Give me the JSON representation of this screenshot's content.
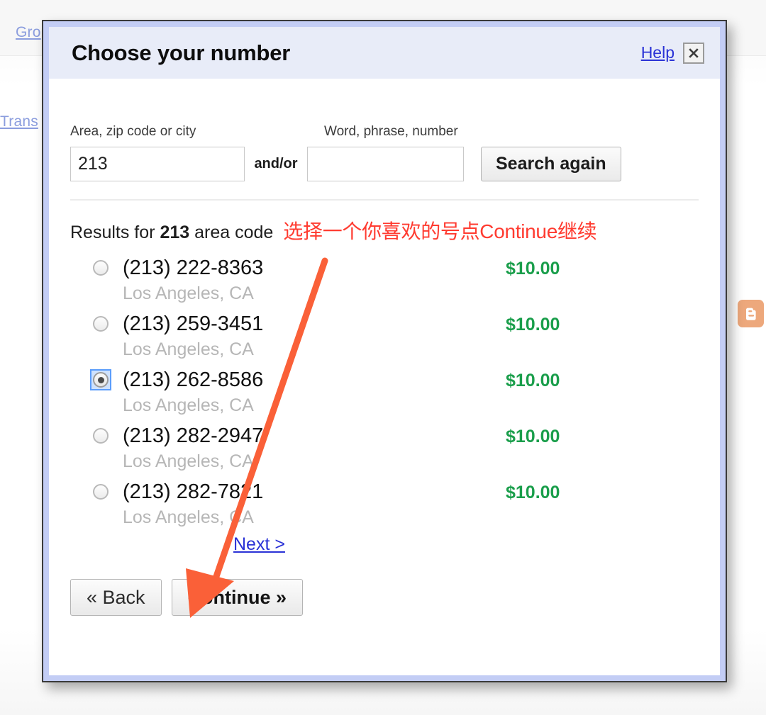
{
  "background": {
    "links": [
      {
        "name": "groups-link",
        "label": "Gro"
      },
      {
        "name": "transfer-link",
        "label": "Trans"
      }
    ],
    "badge": {
      "name": "blogger-badge",
      "icon": "blogger-icon",
      "color": "#eda87c"
    }
  },
  "dialog": {
    "title": "Choose your number",
    "help_label": "Help",
    "close_icon": "close-x-icon",
    "border_color": "#c3cdf5",
    "titlebar_color": "#e8ecf8"
  },
  "search": {
    "area_label": "Area, zip code or city",
    "area_value": "213",
    "area_placeholder": "",
    "conjunction_label": "and/or",
    "word_label": "Word, phrase, number",
    "word_value": "",
    "word_placeholder": "",
    "search_button_label": "Search again"
  },
  "results": {
    "header_prefix": "Results for ",
    "header_query": "213",
    "header_suffix": " area code",
    "annotation": "选择一个你喜欢的号点Continue继续",
    "annotation_color": "#ff3b30",
    "price_color": "#1a9e4b",
    "items": [
      {
        "number": "(213) 222-8363",
        "location": "Los Angeles, CA",
        "price": "$10.00",
        "selected": false
      },
      {
        "number": "(213) 259-3451",
        "location": "Los Angeles, CA",
        "price": "$10.00",
        "selected": false
      },
      {
        "number": "(213) 262-8586",
        "location": "Los Angeles, CA",
        "price": "$10.00",
        "selected": true
      },
      {
        "number": "(213) 282-2947",
        "location": "Los Angeles, CA",
        "price": "$10.00",
        "selected": false
      },
      {
        "number": "(213) 282-7821",
        "location": "Los Angeles, CA",
        "price": "$10.00",
        "selected": false
      }
    ],
    "next_label": "Next >"
  },
  "footer": {
    "back_label": "« Back",
    "continue_label": "Continue »"
  }
}
